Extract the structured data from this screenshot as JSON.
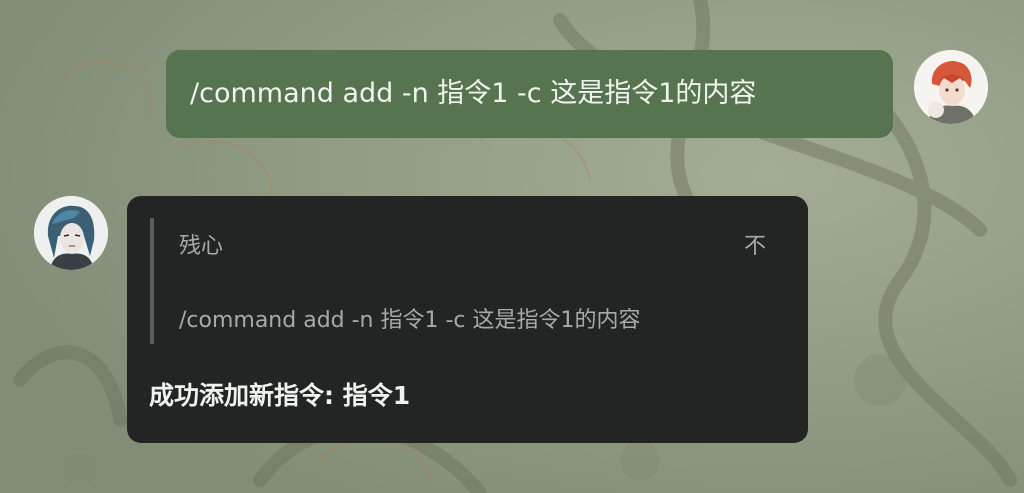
{
  "messages": {
    "outgoing": {
      "text": "/command add -n 指令1 -c 这是指令1的内容"
    },
    "incoming": {
      "quote": {
        "author": "残心",
        "jump_glyph": "不",
        "text": "/command add -n 指令1 -c 这是指令1的内容"
      },
      "reply": "成功添加新指令: 指令1"
    }
  },
  "colors": {
    "outgoing_bubble": "#56744f",
    "incoming_bubble": "#232524",
    "background": "#8d9a82"
  },
  "icons": {
    "self_avatar": "user-avatar-red-hair",
    "bot_avatar": "bot-avatar-blue-hair"
  }
}
